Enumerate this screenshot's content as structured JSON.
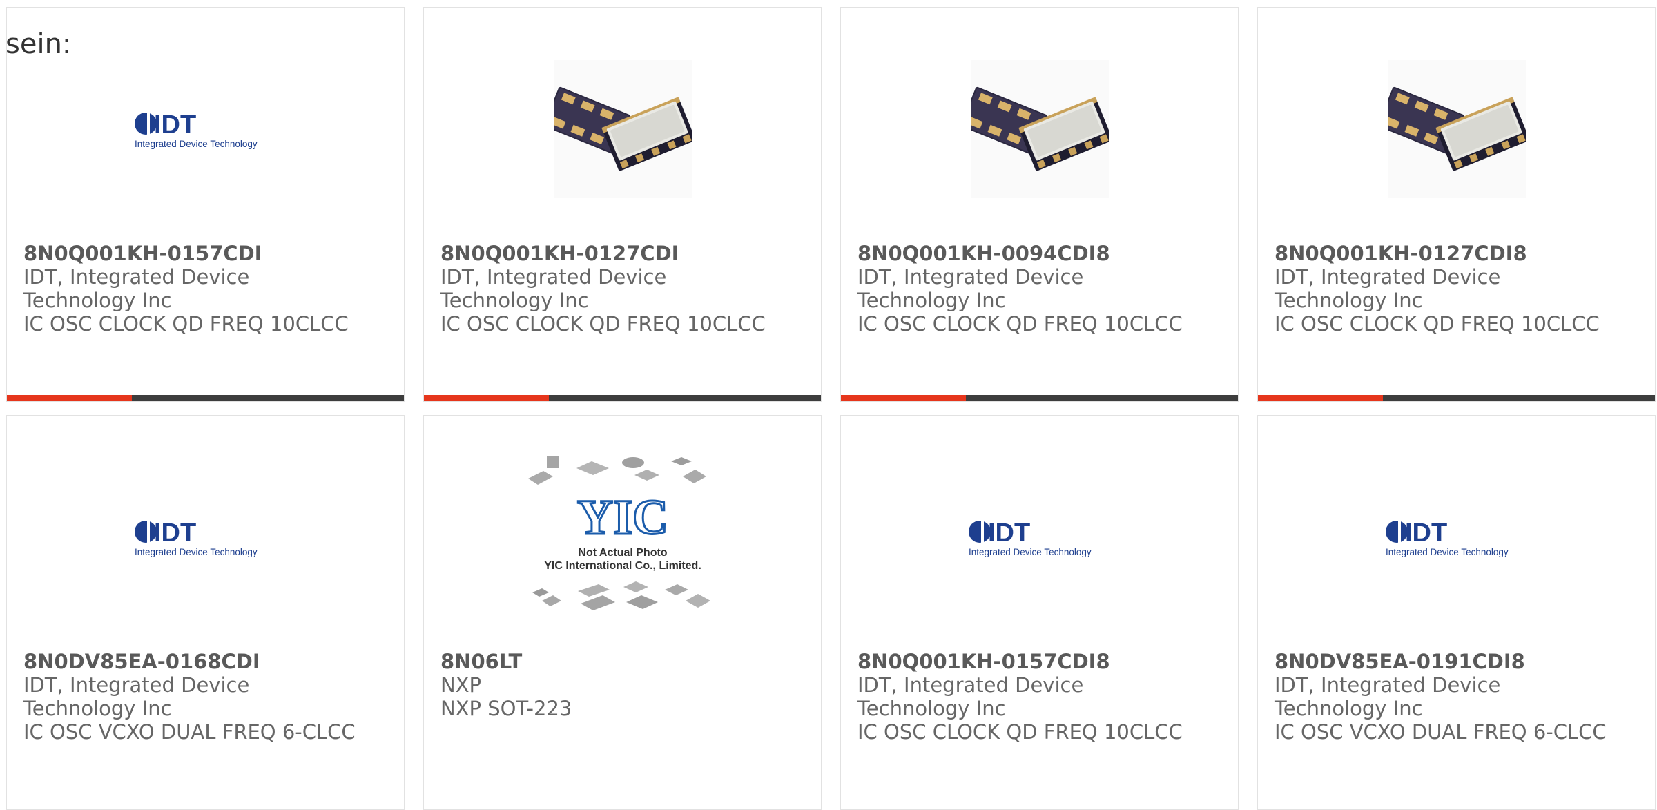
{
  "intro_text": "sein:",
  "colors": {
    "accent_bar": "#e6361c",
    "dark_bar": "#3d3d3d",
    "idt_blue": "#1e3f8f",
    "card_border": "#e2e2e2"
  },
  "logos": {
    "idt": {
      "wordmark": "IDT",
      "tagline": "Integrated Device Technology"
    },
    "yic": {
      "wordmark": "YIC",
      "caption_line1": "Not Actual Photo",
      "caption_line2": "YIC International Co., Limited."
    }
  },
  "products": [
    {
      "part_number": "8N0Q001KH-0157CDI",
      "manufacturer": "IDT, Integrated Device Technology Inc",
      "description": "IC OSC CLOCK QD FREQ 10CLCC",
      "image": "idt-logo",
      "has_accent_bar": true
    },
    {
      "part_number": "8N0Q001KH-0127CDI",
      "manufacturer": "IDT, Integrated Device Technology Inc",
      "description": "IC OSC CLOCK QD FREQ 10CLCC",
      "image": "clcc-package-photo",
      "has_accent_bar": true
    },
    {
      "part_number": "8N0Q001KH-0094CDI8",
      "manufacturer": "IDT, Integrated Device Technology Inc",
      "description": "IC OSC CLOCK QD FREQ 10CLCC",
      "image": "clcc-package-photo",
      "has_accent_bar": true
    },
    {
      "part_number": "8N0Q001KH-0127CDI8",
      "manufacturer": "IDT, Integrated Device Technology Inc",
      "description": "IC OSC CLOCK QD FREQ 10CLCC",
      "image": "clcc-package-photo",
      "has_accent_bar": true
    },
    {
      "part_number": "8N0DV85EA-0168CDI",
      "manufacturer": "IDT, Integrated Device Technology Inc",
      "description": "IC OSC VCXO DUAL FREQ 6-CLCC",
      "image": "idt-logo",
      "has_accent_bar": false
    },
    {
      "part_number": "8N06LT",
      "manufacturer": "NXP",
      "description": "NXP SOT-223",
      "image": "yic-placeholder",
      "has_accent_bar": false
    },
    {
      "part_number": "8N0Q001KH-0157CDI8",
      "manufacturer": "IDT, Integrated Device Technology Inc",
      "description": "IC OSC CLOCK QD FREQ 10CLCC",
      "image": "idt-logo",
      "has_accent_bar": false
    },
    {
      "part_number": "8N0DV85EA-0191CDI8",
      "manufacturer": "IDT, Integrated Device Technology Inc",
      "description": "IC OSC VCXO DUAL FREQ 6-CLCC",
      "image": "idt-logo",
      "has_accent_bar": false
    }
  ]
}
